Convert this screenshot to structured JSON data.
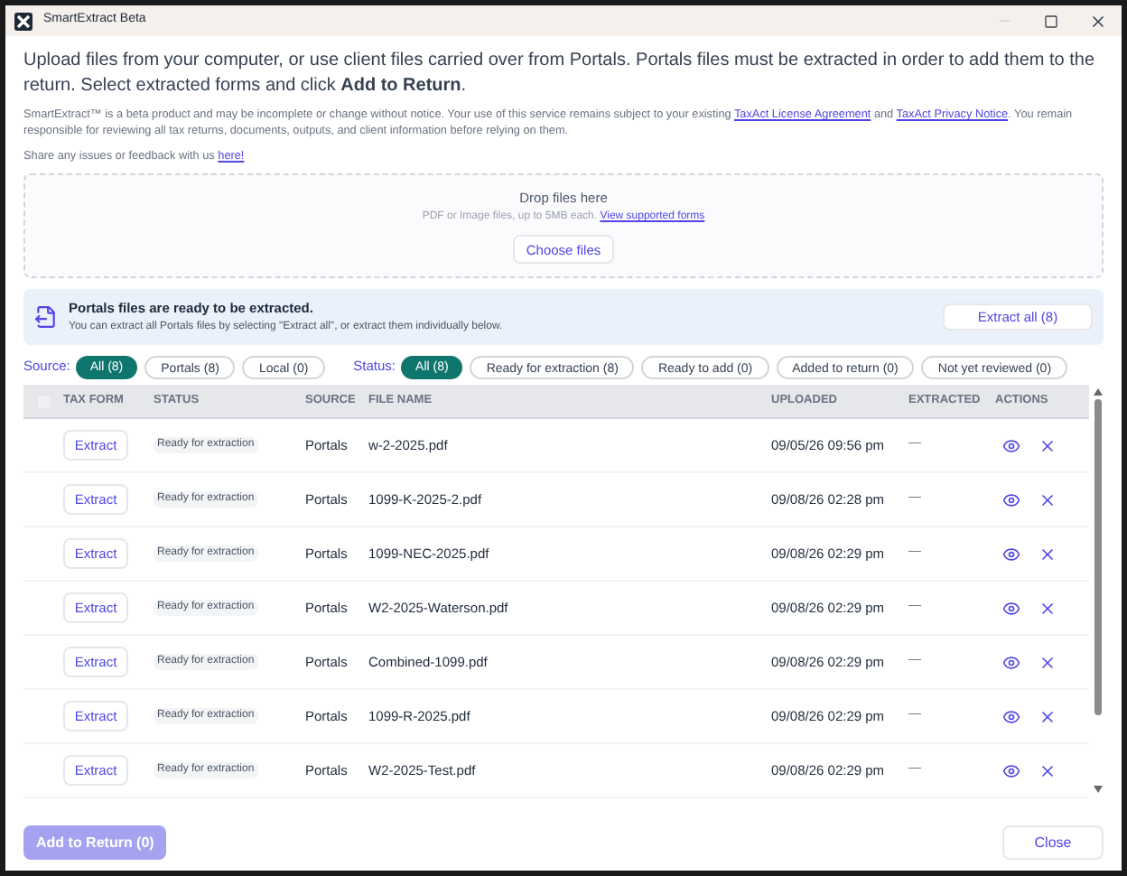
{
  "window": {
    "title": "SmartExtract Beta",
    "minimize_disabled": true
  },
  "intro": "Upload files from your computer, or use client files carried over from Portals. Portals files must be extracted in order to add them to the return. Select extracted forms and click **Add to Return**.",
  "disclaimer": {
    "before": "SmartExtract™ is a beta product and may be incomplete or change without notice. Your use of this service remains subject to your existing",
    "link_1": "TaxAct License Agreement",
    "middle": "and",
    "link_2": "TaxAct Privacy Notice",
    "after": ". You remain responsible for reviewing all tax returns, documents, outputs, and client information before relying on them."
  },
  "feedback": {
    "text": "Share any issues or feedback with us",
    "link": "here!"
  },
  "dropzone": {
    "title": "Drop files here",
    "hint": "PDF or Image files, up to 5MB each.",
    "link": "View supported forms",
    "button": "Choose files"
  },
  "banner": {
    "title": "Portals files are ready to be extracted.",
    "text": "You can extract all Portals files by selecting \"Extract all\", or extract them individually below.",
    "button": "Extract all (8)"
  },
  "source_filter": {
    "label": "Source:",
    "options": [
      {
        "label": "All (8)",
        "selected": true
      },
      {
        "label": "Portals (8)",
        "selected": false
      },
      {
        "label": "Local (0)",
        "selected": false
      }
    ]
  },
  "status_filter": {
    "label": "Status:",
    "options": [
      {
        "label": "All (8)",
        "selected": true
      },
      {
        "label": "Ready for extraction (8)",
        "selected": false
      },
      {
        "label": "Ready to add (0)",
        "selected": false
      },
      {
        "label": "Added to return (0)",
        "selected": false
      },
      {
        "label": "Not yet reviewed (0)",
        "selected": false
      }
    ]
  },
  "table": {
    "select_all": {
      "checked": false
    },
    "columns": [
      "TAX FORM",
      "STATUS",
      "SOURCE",
      "FILE NAME",
      "UPLOADED",
      "EXTRACTED",
      "ACTIONS"
    ],
    "rows": [
      {
        "action": "Extract",
        "status": "Ready for extraction",
        "source": "Portals",
        "file_name": "w-2-2025.pdf",
        "uploaded": "09/05/26 09:56 pm",
        "extracted": "—"
      },
      {
        "action": "Extract",
        "status": "Ready for extraction",
        "source": "Portals",
        "file_name": "1099-K-2025-2.pdf",
        "uploaded": "09/08/26 02:28 pm",
        "extracted": "—"
      },
      {
        "action": "Extract",
        "status": "Ready for extraction",
        "source": "Portals",
        "file_name": "1099-NEC-2025.pdf",
        "uploaded": "09/08/26 02:29 pm",
        "extracted": "—"
      },
      {
        "action": "Extract",
        "status": "Ready for extraction",
        "source": "Portals",
        "file_name": "W2-2025-Waterson.pdf",
        "uploaded": "09/08/26 02:29 pm",
        "extracted": "—"
      },
      {
        "action": "Extract",
        "status": "Ready for extraction",
        "source": "Portals",
        "file_name": "Combined-1099.pdf",
        "uploaded": "09/08/26 02:29 pm",
        "extracted": "—"
      },
      {
        "action": "Extract",
        "status": "Ready for extraction",
        "source": "Portals",
        "file_name": "1099-R-2025.pdf",
        "uploaded": "09/08/26 02:29 pm",
        "extracted": "—"
      },
      {
        "action": "Extract",
        "status": "Ready for extraction",
        "source": "Portals",
        "file_name": "W2-2025-Test.pdf",
        "uploaded": "09/08/26 02:29 pm",
        "extracted": "—"
      }
    ]
  },
  "footer": {
    "add_button": {
      "label": "Add to Return (0)",
      "disabled": true
    },
    "close_button": "Close"
  }
}
